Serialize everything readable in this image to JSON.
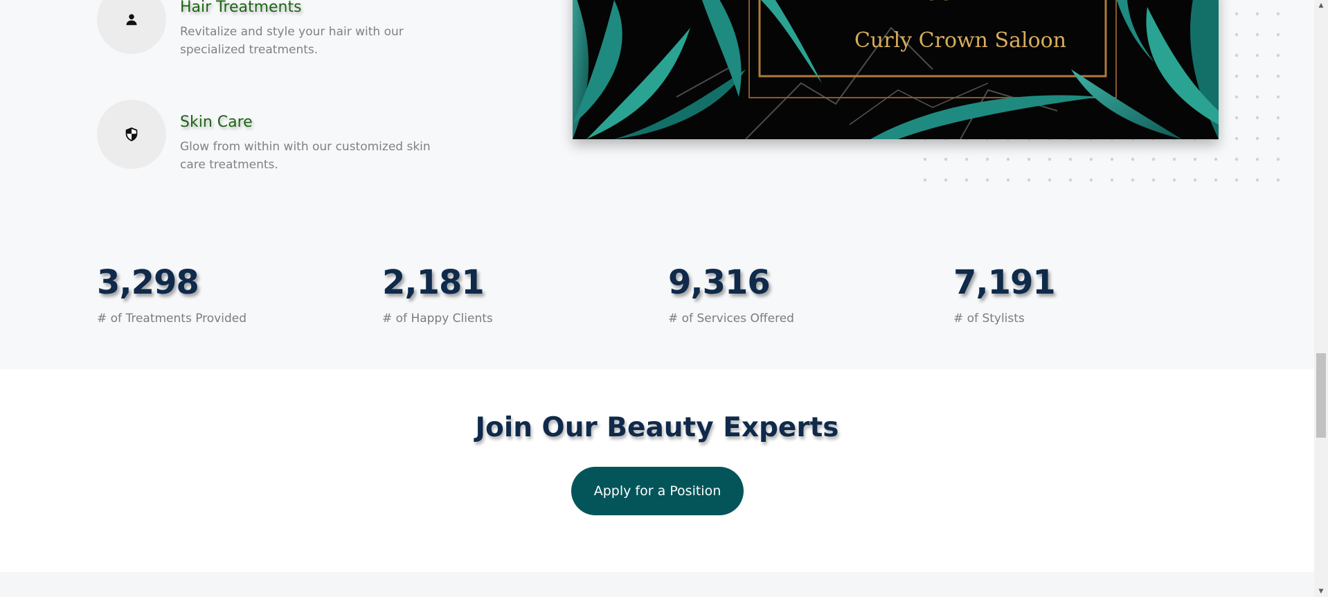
{
  "services": [
    {
      "title": "Hair Treatments",
      "description": "Revitalize and style your hair with our specialized treatments.",
      "icon": "person-icon"
    },
    {
      "title": "Skin Care",
      "description": "Glow from within with our customized skin care treatments.",
      "icon": "shield-icon"
    }
  ],
  "hero_image": {
    "text_top": "to",
    "text_main": "Curly Crown Saloon",
    "gold": "#d7ad5c",
    "leaf": "#1f8a80"
  },
  "stats": [
    {
      "number": "3,298",
      "label": "# of Treatments Provided"
    },
    {
      "number": "2,181",
      "label": "# of Happy Clients"
    },
    {
      "number": "9,316",
      "label": "# of Services Offered"
    },
    {
      "number": "7,191",
      "label": "# of Stylists"
    }
  ],
  "join": {
    "title": "Join Our Beauty Experts",
    "button_label": "Apply for a Position"
  },
  "colors": {
    "accent": "#04555a",
    "heading": "#0f2a4a",
    "service_title": "#1d6414"
  }
}
